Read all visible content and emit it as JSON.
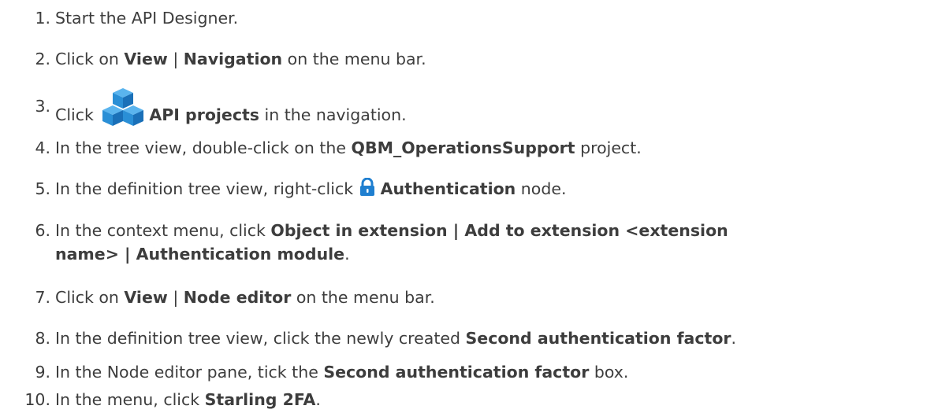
{
  "steps": [
    {
      "number": "1.",
      "parts": [
        "Start the API Designer."
      ]
    },
    {
      "number": "2.",
      "parts": [
        "Click on ",
        "View",
        " | ",
        "Navigation",
        " on the menu bar."
      ]
    },
    {
      "number": "3.",
      "parts": [
        "Click ",
        "API projects",
        " in the navigation."
      ],
      "icon": "stacked-cubes-icon"
    },
    {
      "number": "4.",
      "parts": [
        "In the tree view, double-click on the ",
        "QBM_OperationsSupport",
        " project."
      ]
    },
    {
      "number": "5.",
      "parts": [
        "In the definition tree view, right-click ",
        "Authentication",
        " node."
      ],
      "icon": "lock-icon"
    },
    {
      "number": "6.",
      "parts": [
        "In the context menu, click ",
        "Object in extension",
        " | ",
        "Add to extension <extension",
        "name>",
        " | ",
        "Authentication module",
        "."
      ]
    },
    {
      "number": "7.",
      "parts": [
        "Click on ",
        "View",
        " | ",
        "Node editor",
        " on the menu bar."
      ]
    },
    {
      "number": "8.",
      "parts": [
        "In the definition tree view, click the newly created ",
        "Second authentication factor",
        "."
      ]
    },
    {
      "number": "9.",
      "parts": [
        "In the Node editor pane, tick the ",
        "Second authentication factor",
        " box."
      ]
    },
    {
      "number": "10.",
      "parts": [
        "In the menu, click ",
        "Starling 2FA",
        "."
      ]
    }
  ],
  "colors": {
    "text": "#3d3d3d",
    "icon_blue": "#2a8fd6",
    "lock_blue": "#1f7fd0"
  }
}
